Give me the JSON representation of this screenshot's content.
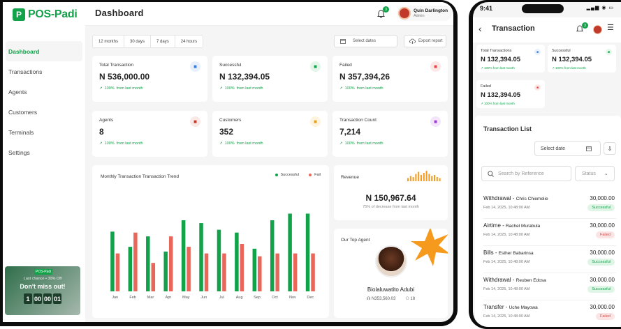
{
  "brand": {
    "name": "POS-Padi",
    "logo_letter": "P"
  },
  "sidebar": {
    "items": [
      {
        "label": "Dashboard",
        "active": true
      },
      {
        "label": "Transactions"
      },
      {
        "label": "Agents"
      },
      {
        "label": "Customers"
      },
      {
        "label": "Terminals"
      },
      {
        "label": "Settings"
      }
    ],
    "promo": {
      "logo": "POS-Padi",
      "line1": "Last chance • 30% Off",
      "line2": "Don't miss out!",
      "timer": [
        "1",
        "00",
        "00",
        "01"
      ]
    }
  },
  "header": {
    "title": "Dashboard",
    "notification_count": "3",
    "user_name": "Quin Darlington",
    "user_role": "Admin"
  },
  "filters": {
    "ranges": [
      "12 months",
      "30 days",
      "7 days",
      "24 hours"
    ],
    "select_dates": "Select dates",
    "export": "Export report"
  },
  "kpis": [
    {
      "label": "Total Transaction",
      "value": "N 536,000.00",
      "pct": "100%",
      "from": "from last month",
      "icon": "wallet-icon",
      "color": "#3a7bd5",
      "bg": "#e8f0fc"
    },
    {
      "label": "Successful",
      "value": "N 132,394.05",
      "pct": "100%",
      "from": "from last month",
      "icon": "check-wallet-icon",
      "color": "#12a24a",
      "bg": "#e4f6ea"
    },
    {
      "label": "Failed",
      "value": "N 357,394,26",
      "pct": "100%",
      "from": "from last month",
      "icon": "x-wallet-icon",
      "color": "#e04848",
      "bg": "#fde8e8"
    },
    {
      "label": "Agents",
      "value": "8",
      "pct": "100%",
      "from": "from last month",
      "icon": "agents-icon",
      "color": "#c0392b",
      "bg": "#f9e9e6"
    },
    {
      "label": "Customers",
      "value": "352",
      "pct": "100%",
      "from": "from last month",
      "icon": "customers-icon",
      "color": "#e0a020",
      "bg": "#fdf3de"
    },
    {
      "label": "Transaction Count",
      "value": "7,214",
      "pct": "100%",
      "from": "from last month",
      "icon": "count-icon",
      "color": "#9b3dd1",
      "bg": "#f3e6fb"
    }
  ],
  "chart": {
    "title": "Monthly Transaction Transaction Trend",
    "legend_success": "Successful",
    "legend_fail": "Fail",
    "success_color": "#12a24a",
    "fail_color": "#e8675a"
  },
  "chart_data": {
    "type": "bar",
    "categories": [
      "Jan",
      "Feb",
      "Mar",
      "Apr",
      "May",
      "Jun",
      "Jul",
      "Aug",
      "Sep",
      "Oct",
      "Nov",
      "Dec"
    ],
    "series": [
      {
        "name": "Successful",
        "values": [
          63,
          47,
          58,
          42,
          75,
          72,
          65,
          62,
          45,
          75,
          82,
          82
        ]
      },
      {
        "name": "Fail",
        "values": [
          40,
          62,
          30,
          58,
          47,
          40,
          40,
          50,
          37,
          40,
          40,
          40
        ]
      }
    ],
    "ylim": [
      0,
      100
    ]
  },
  "revenue": {
    "label": "Revenue",
    "value": "N 150,967.64",
    "sub": "75% of decrease from last month",
    "spark": [
      3,
      5,
      4,
      7,
      9,
      6,
      8,
      10,
      7,
      5,
      6,
      4,
      3
    ]
  },
  "top_agent": {
    "title": "Our Top Agent",
    "name": "Biolaluwatito Adubi",
    "amount": "N353,560.03",
    "count": "18"
  },
  "mobile": {
    "time": "9:41",
    "title": "Transaction",
    "notification_count": "3",
    "cards": [
      {
        "label": "Total Transactions",
        "value": "N 132,394.05",
        "trend": "100% from last month",
        "color": "#3a7bd5",
        "bg": "#e8f0fc"
      },
      {
        "label": "Successful",
        "value": "N 132,394.05",
        "trend": "100% from last month",
        "color": "#12a24a",
        "bg": "#e4f6ea"
      },
      {
        "label": "Failed",
        "value": "N 132,394.05",
        "trend": "100% from last month",
        "color": "#e04848",
        "bg": "#fde8e8"
      }
    ],
    "list_title": "Transaction List",
    "select_date": "Select date",
    "search_placeholder": "Search by Reference",
    "status_filter": "Status",
    "transactions": [
      {
        "type": "Withdrawal",
        "name": "Chris Chiemelie",
        "amount": "30,000.00",
        "date": "Feb 14, 2025, 10:48:00 AM",
        "status": "Successful",
        "ok": true
      },
      {
        "type": "Airtime",
        "name": "Rachel Murabula",
        "amount": "30,000.00",
        "date": "Feb 14, 2025, 10:48:00 AM",
        "status": "Failed",
        "ok": false
      },
      {
        "type": "Bills",
        "name": "Esther Babarinsa",
        "amount": "30,000.00",
        "date": "Feb 14, 2025, 10:48:00 AM",
        "status": "Successful",
        "ok": true
      },
      {
        "type": "Withdrawal",
        "name": "Reuben Edosa",
        "amount": "30,000.00",
        "date": "Feb 14, 2025, 10:48:00 AM",
        "status": "Successful",
        "ok": true
      },
      {
        "type": "Transfer",
        "name": "Uche Mayowa",
        "amount": "30,000.00",
        "date": "Feb 14, 2025, 10:48:00 AM",
        "status": "Failed",
        "ok": false
      }
    ]
  }
}
